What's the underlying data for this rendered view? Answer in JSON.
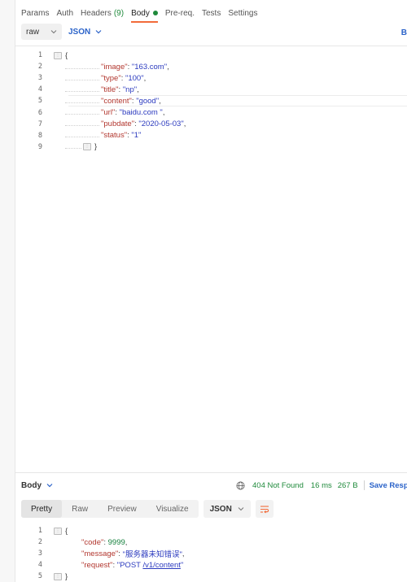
{
  "request_tabs": [
    {
      "label": "Params"
    },
    {
      "label": "Auth"
    },
    {
      "label": "Headers",
      "count": "(9)"
    },
    {
      "label": "Body",
      "active": true
    },
    {
      "label": "Pre-req."
    },
    {
      "label": "Tests"
    },
    {
      "label": "Settings"
    }
  ],
  "body_options": {
    "mode": "raw",
    "language": "JSON",
    "beautify_label": "B"
  },
  "request_editor": {
    "line_numbers": [
      "1",
      "2",
      "3",
      "4",
      "5",
      "6",
      "7",
      "8",
      "9"
    ],
    "lines": [
      {
        "open": "{"
      },
      {
        "key": "\"image\"",
        "value": "\"163.com\"",
        "trail": ","
      },
      {
        "key": "\"type\"",
        "value": "\"100\"",
        "trail": ","
      },
      {
        "key": "\"title\"",
        "value": "\"np\"",
        "trail": ","
      },
      {
        "key": "\"content\"",
        "value": "\"good\"",
        "trail": ","
      },
      {
        "key": "\"url\"",
        "value": "\"baidu.com \"",
        "trail": ","
      },
      {
        "key": "\"pubdate\"",
        "value": "\"2020-05-03\"",
        "trail": ","
      },
      {
        "key": "\"status\"",
        "value": "\"1\"",
        "trail": ""
      },
      {
        "close": "}"
      }
    ]
  },
  "response": {
    "body_label": "Body",
    "status": "404 Not Found",
    "time": "16 ms",
    "size": "267 B",
    "save_label": "Save Resp",
    "view_tabs": [
      "Pretty",
      "Raw",
      "Preview",
      "Visualize"
    ],
    "active_view": "Pretty",
    "format": "JSON",
    "line_numbers": [
      "1",
      "2",
      "3",
      "4",
      "5"
    ],
    "lines": [
      {
        "open": "{"
      },
      {
        "key": "\"code\"",
        "value": "9999",
        "trail": ",",
        "numeric": true
      },
      {
        "key": "\"message\"",
        "value": "\"服务器未知错误\"",
        "trail": ","
      },
      {
        "key": "\"request\"",
        "value_prefix": "\"POST ",
        "value_link": "/v1/content",
        "value_suffix": "\"",
        "trail": ""
      },
      {
        "close": "}"
      }
    ]
  },
  "colors": {
    "accent_orange": "#f26b3a",
    "status_green": "#1f8a3b",
    "link_blue": "#2b63c9",
    "json_key": "#b2372f",
    "json_string": "#2c3bbf"
  }
}
